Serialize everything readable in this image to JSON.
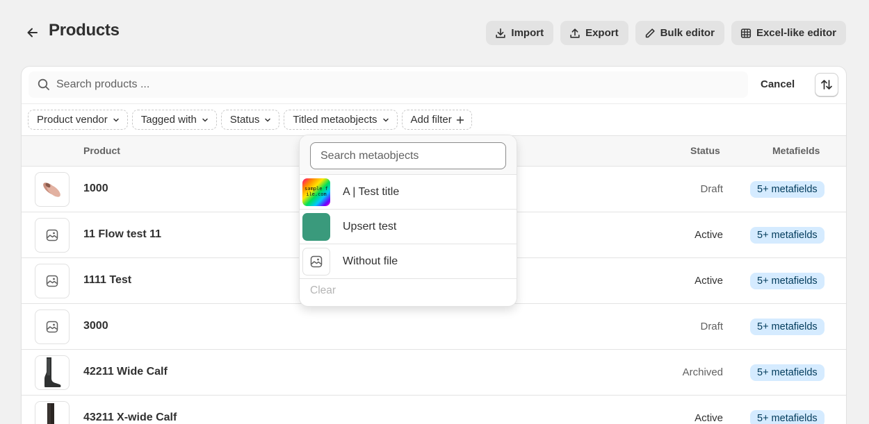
{
  "header": {
    "title": "Products",
    "actions": [
      {
        "label": "Import",
        "icon": "import-icon"
      },
      {
        "label": "Export",
        "icon": "export-icon"
      },
      {
        "label": "Bulk editor",
        "icon": "pencil-icon"
      },
      {
        "label": "Excel-like editor",
        "icon": "grid-icon"
      }
    ]
  },
  "search": {
    "placeholder": "Search products ...",
    "value": "",
    "cancel_label": "Cancel"
  },
  "filters": [
    "Product vendor",
    "Tagged with",
    "Status",
    "Titled metaobjects",
    "Add filter"
  ],
  "table": {
    "columns": {
      "product": "Product",
      "status": "Status",
      "metafields": "Metafields"
    },
    "rows": [
      {
        "name": "1000",
        "status": "Draft",
        "metafields": "5+ metafields",
        "thumb": "slippers-image"
      },
      {
        "name": "11 Flow test 11",
        "status": "Active",
        "metafields": "5+ metafields",
        "thumb": "placeholder-image-icon"
      },
      {
        "name": "1111 Test",
        "status": "Active",
        "metafields": "5+ metafields",
        "thumb": "placeholder-image-icon"
      },
      {
        "name": "3000",
        "status": "Draft",
        "metafields": "5+ metafields",
        "thumb": "placeholder-image-icon"
      },
      {
        "name": "42211 Wide Calf",
        "status": "Archived",
        "metafields": "5+ metafields",
        "thumb": "boot-image"
      },
      {
        "name": "43211 X-wide Calf",
        "status": "Active",
        "metafields": "5+ metafields",
        "thumb": "boot-image"
      }
    ]
  },
  "metaobject_popover": {
    "search_placeholder": "Search metaobjects",
    "items": [
      {
        "label": "A | Test title",
        "thumb": "rainbow-sample-image",
        "thumb_text": "sample file.com"
      },
      {
        "label": "Upsert test",
        "thumb": "green-swatch",
        "color": "#3a9a7c"
      },
      {
        "label": "Without file",
        "thumb": "placeholder-image-icon"
      }
    ],
    "clear_label": "Clear"
  },
  "colors": {
    "background": "#f1f1f1",
    "badge_bg": "#d5ebff",
    "badge_text": "#003a5a"
  }
}
